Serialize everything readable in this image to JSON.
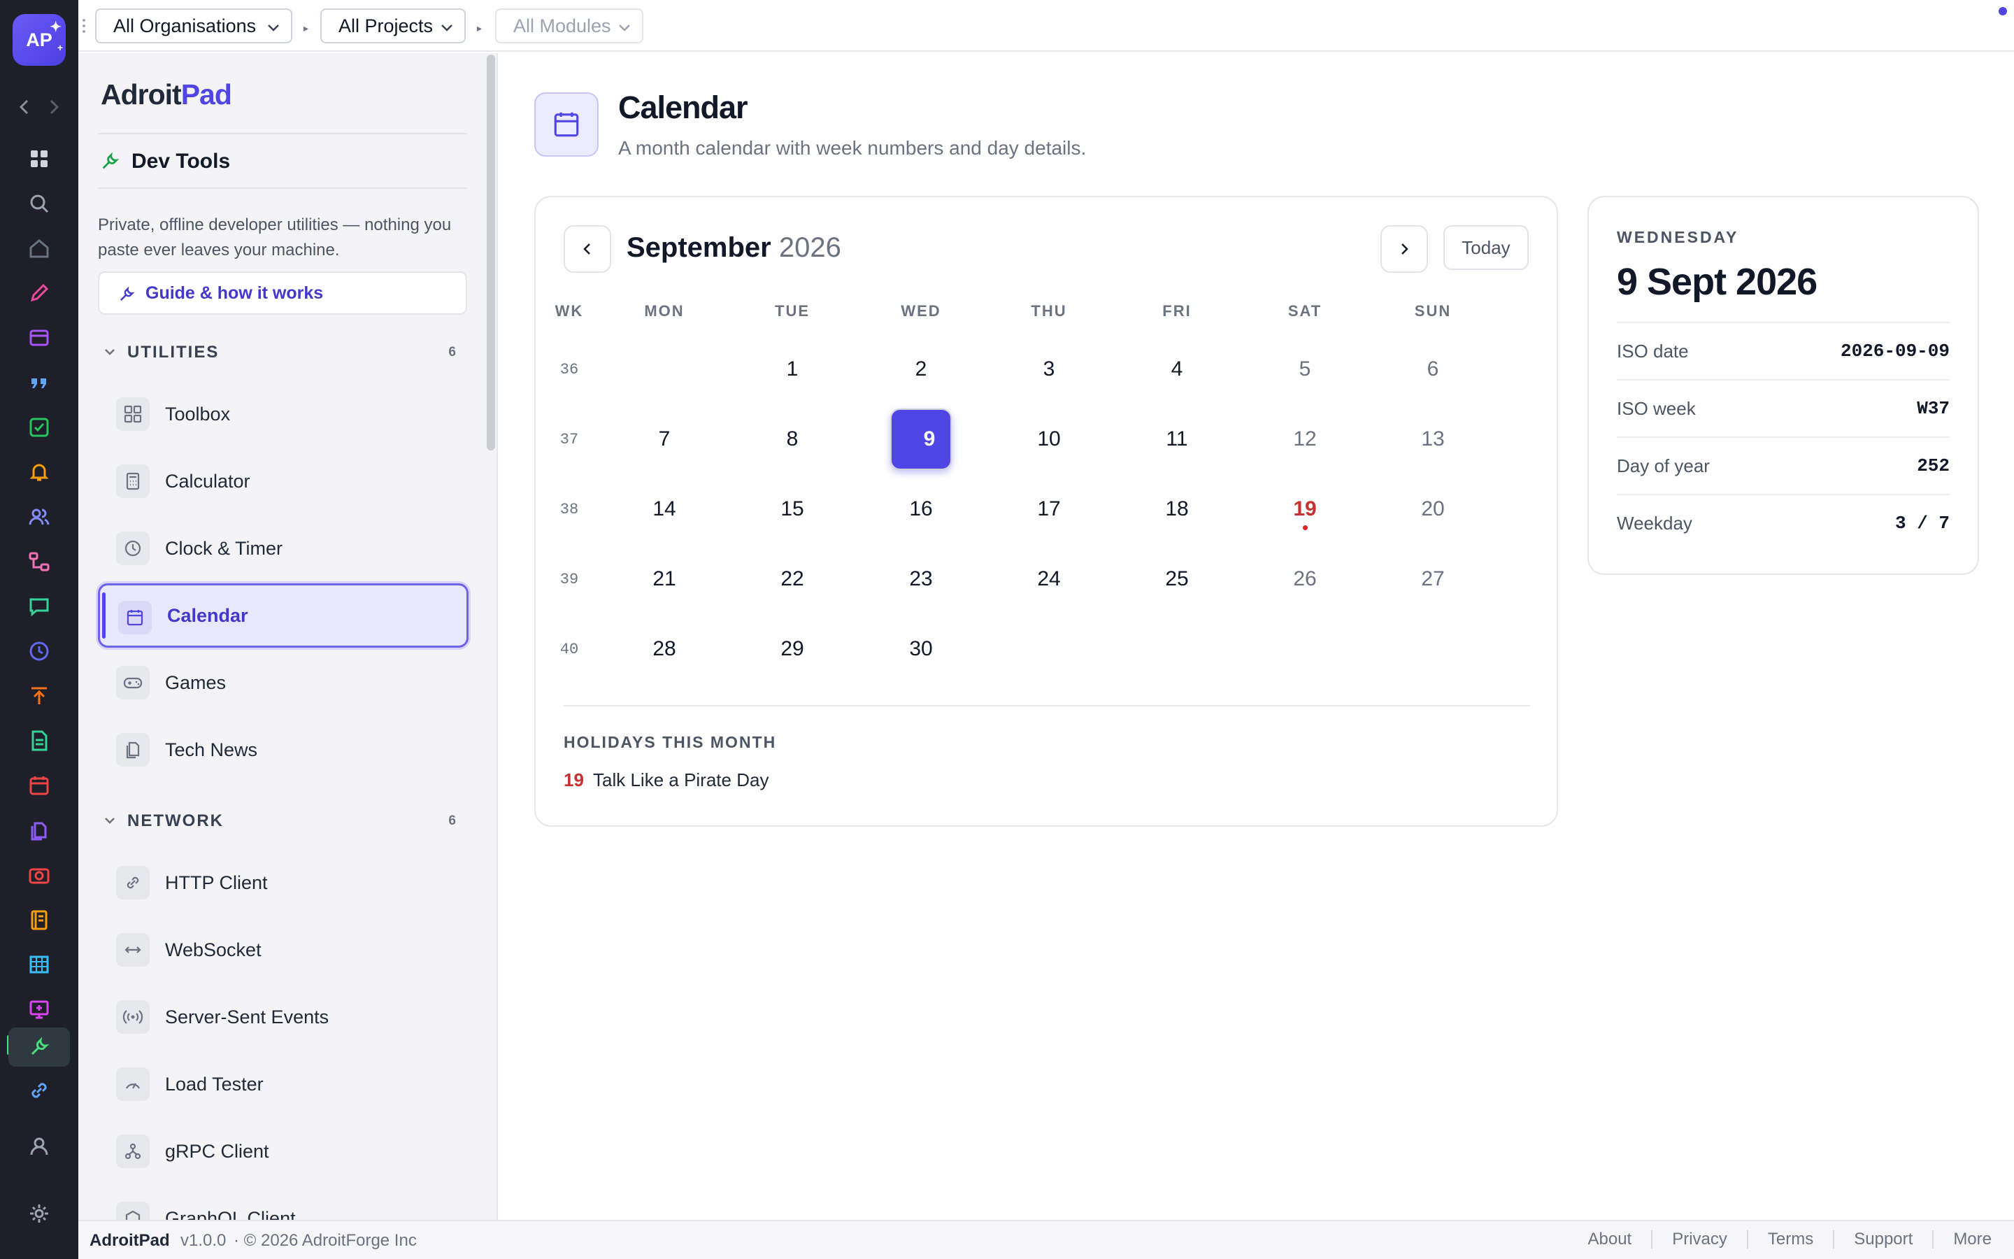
{
  "rail": {
    "logo_text": "AP",
    "icons": [
      "grid-icon",
      "search-icon",
      "home-icon",
      "pencil-icon",
      "archive-icon",
      "quote-icon",
      "checkbox-icon",
      "bell-icon",
      "users-icon",
      "flow-icon",
      "chat-icon",
      "clock-icon",
      "upload-icon",
      "document-icon",
      "calendar-icon",
      "files-icon",
      "camera-icon",
      "notebook-icon",
      "table-icon",
      "presentation-icon",
      "wrench-icon",
      "link-icon",
      "user-icon",
      "settings-icon"
    ],
    "active": "wrench-icon"
  },
  "topbar": {
    "org_select": "All Organisations",
    "project_select": "All Projects",
    "module_select": "All Modules"
  },
  "sidebar": {
    "brand_a": "Adroit",
    "brand_b": "Pad",
    "workspace": "Dev Tools",
    "description": "Private, offline developer utilities — nothing you paste ever leaves your machine.",
    "guide_button": "Guide & how it works",
    "sections": [
      {
        "title": "UTILITIES",
        "count": "6",
        "items": [
          {
            "label": "Toolbox",
            "icon": "toolbox-icon"
          },
          {
            "label": "Calculator",
            "icon": "calculator-icon"
          },
          {
            "label": "Clock & Timer",
            "icon": "clock-icon"
          },
          {
            "label": "Calendar",
            "icon": "calendar-icon",
            "active": true
          },
          {
            "label": "Games",
            "icon": "gamepad-icon"
          },
          {
            "label": "Tech News",
            "icon": "newspaper-icon"
          }
        ]
      },
      {
        "title": "NETWORK",
        "count": "6",
        "items": [
          {
            "label": "HTTP Client",
            "icon": "link-icon"
          },
          {
            "label": "WebSocket",
            "icon": "arrows-horizontal-icon"
          },
          {
            "label": "Server-Sent Events",
            "icon": "broadcast-icon"
          },
          {
            "label": "Load Tester",
            "icon": "gauge-icon"
          },
          {
            "label": "gRPC Client",
            "icon": "network-icon"
          },
          {
            "label": "GraphQL Client",
            "icon": "graphql-icon"
          }
        ]
      }
    ]
  },
  "main": {
    "title": "Calendar",
    "subtitle": "A month calendar with week numbers and day details.",
    "calendar": {
      "month": "September",
      "year": "2026",
      "today_button": "Today",
      "headers": [
        "WK",
        "MON",
        "TUE",
        "WED",
        "THU",
        "FRI",
        "SAT",
        "SUN"
      ],
      "weeks": [
        {
          "wk": "36",
          "days": [
            "",
            "1",
            "2",
            "3",
            "4",
            "5",
            "6"
          ]
        },
        {
          "wk": "37",
          "days": [
            "7",
            "8",
            "9",
            "10",
            "11",
            "12",
            "13"
          ]
        },
        {
          "wk": "38",
          "days": [
            "14",
            "15",
            "16",
            "17",
            "18",
            "19",
            "20"
          ]
        },
        {
          "wk": "39",
          "days": [
            "21",
            "22",
            "23",
            "24",
            "25",
            "26",
            "27"
          ]
        },
        {
          "wk": "40",
          "days": [
            "28",
            "29",
            "30",
            "",
            "",
            "",
            ""
          ]
        }
      ],
      "selected_day": "9",
      "holiday_days": [
        "19"
      ],
      "holidays_title": "HOLIDAYS THIS MONTH",
      "holidays": [
        {
          "day": "19",
          "name": "Talk Like a Pirate Day"
        }
      ]
    },
    "details": {
      "weekday": "WEDNESDAY",
      "date": "9 Sept 2026",
      "rows": [
        {
          "key": "ISO date",
          "value": "2026-09-09"
        },
        {
          "key": "ISO week",
          "value": "W37"
        },
        {
          "key": "Day of year",
          "value": "252"
        },
        {
          "key": "Weekday",
          "value": "3 / 7"
        }
      ]
    }
  },
  "footer": {
    "brand": "AdroitPad",
    "version": "v1.0.0",
    "copyright": "· © 2026 AdroitForge Inc",
    "links": [
      "About",
      "Privacy",
      "Terms",
      "Support",
      "More"
    ]
  },
  "colors": {
    "accent": "#4f46e5",
    "rail_bg": "#1f1f29",
    "holiday": "#c53030"
  }
}
